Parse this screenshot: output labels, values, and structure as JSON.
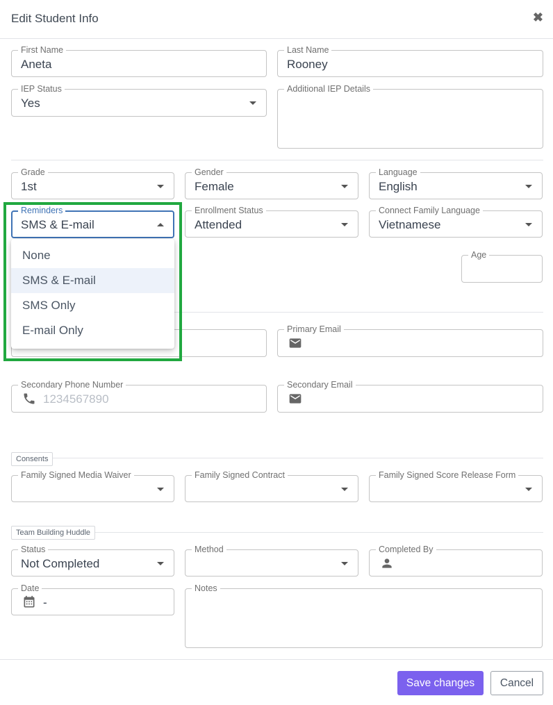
{
  "modal": {
    "title": "Edit Student Info",
    "close_icon": "close-icon"
  },
  "fields": {
    "first_name": {
      "label": "First Name",
      "value": "Aneta"
    },
    "last_name": {
      "label": "Last Name",
      "value": "Rooney"
    },
    "iep_status": {
      "label": "IEP Status",
      "value": "Yes"
    },
    "additional_iep": {
      "label": "Additional IEP Details",
      "value": ""
    },
    "grade": {
      "label": "Grade",
      "value": "1st"
    },
    "gender": {
      "label": "Gender",
      "value": "Female"
    },
    "language": {
      "label": "Language",
      "value": "English"
    },
    "reminders": {
      "label": "Reminders",
      "value": "SMS & E-mail"
    },
    "enrollment_status": {
      "label": "Enrollment Status",
      "value": "Attended"
    },
    "connect_family_language": {
      "label": "Connect Family Language",
      "value": "Vietnamese"
    },
    "age": {
      "label": "Age",
      "value": ""
    },
    "primary_email": {
      "label": "Primary Email",
      "value": ""
    },
    "secondary_phone": {
      "label": "Secondary Phone Number",
      "placeholder": "1234567890"
    },
    "secondary_email": {
      "label": "Secondary Email",
      "value": ""
    }
  },
  "reminders_menu": {
    "options": [
      "None",
      "SMS & E-mail",
      "SMS Only",
      "E-mail Only"
    ],
    "selected_index": 1
  },
  "consents": {
    "section_label": "Consents",
    "media_waiver": {
      "label": "Family Signed Media Waiver",
      "value": ""
    },
    "contract": {
      "label": "Family Signed Contract",
      "value": ""
    },
    "score_release": {
      "label": "Family Signed Score Release Form",
      "value": ""
    }
  },
  "huddle": {
    "section_label": "Team Building Huddle",
    "status": {
      "label": "Status",
      "value": "Not Completed"
    },
    "method": {
      "label": "Method",
      "value": ""
    },
    "completed_by": {
      "label": "Completed By",
      "value": ""
    },
    "date": {
      "label": "Date",
      "value": "-"
    },
    "notes": {
      "label": "Notes",
      "value": ""
    }
  },
  "footer": {
    "save_label": "Save changes",
    "cancel_label": "Cancel"
  },
  "colors": {
    "accent": "#7b61ee",
    "focus": "#3f73b5",
    "highlight": "#21a840"
  },
  "icons": [
    "close-icon",
    "chevron-down-icon",
    "chevron-up-icon",
    "email-icon",
    "phone-icon",
    "person-icon",
    "calendar-icon"
  ]
}
